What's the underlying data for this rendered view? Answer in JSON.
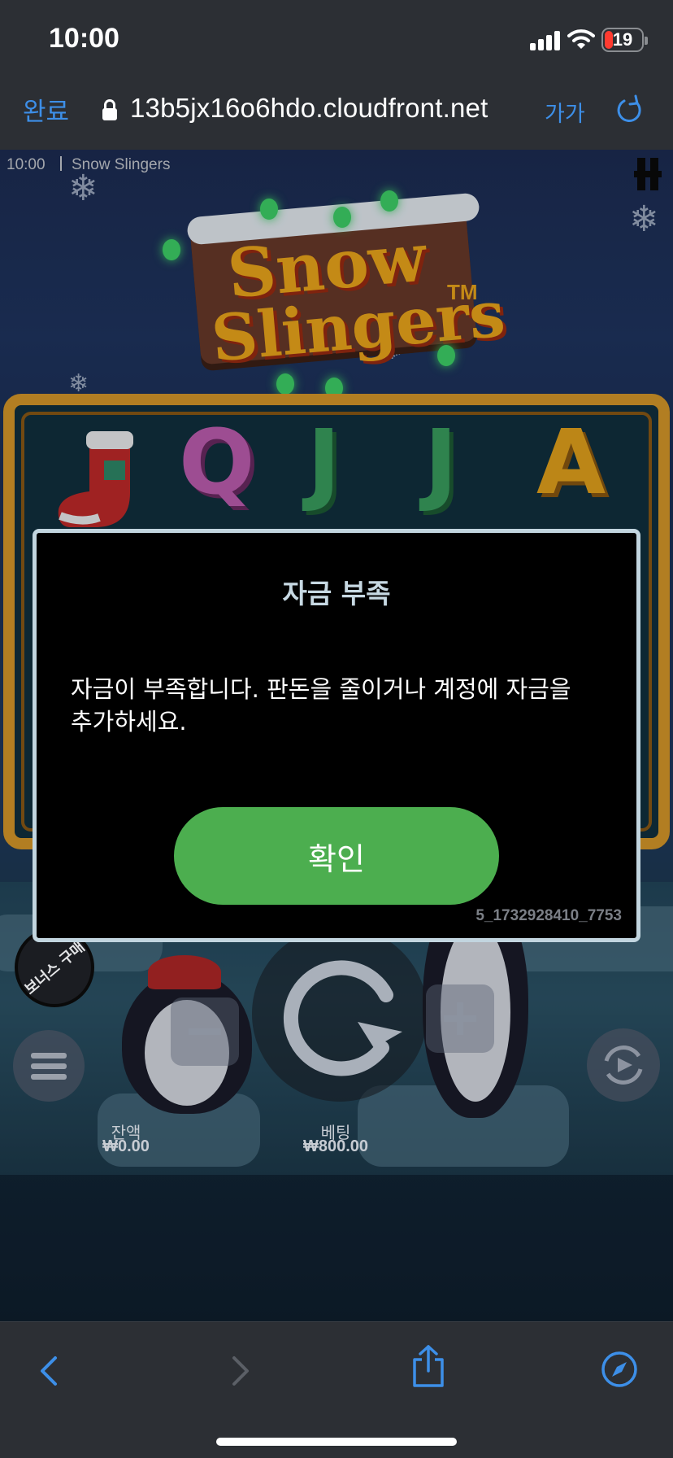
{
  "status_bar": {
    "time": "10:00",
    "battery": "19"
  },
  "url_bar": {
    "done_label": "완료",
    "url": "13b5jx16o6hdo.cloudfront.net",
    "text_size_label": "가가"
  },
  "game": {
    "clock": "10:00",
    "title": "Snow Slingers",
    "logo_line1": "Snow",
    "logo_line2": "Slingers",
    "logo_tm": "TM",
    "reel_symbols": [
      "Q",
      "J",
      "J",
      "A"
    ],
    "bonus_buy_label": "보너스 구매",
    "balance_label": "잔액",
    "balance_value": "₩0.00",
    "bet_label": "베팅",
    "bet_value": "₩800.00"
  },
  "modal": {
    "title": "자금 부족",
    "message_line1": "자금이 부족합니다. 판돈을 줄이거나 계정에 자금을",
    "message_line2": "추가하세요.",
    "confirm_label": "확인",
    "session_id": "5_1732928410_7753"
  },
  "colors": {
    "accent_blue": "#3d8fe8",
    "confirm_green": "#4cae4f",
    "battery_red": "#ff3b30",
    "modal_border": "#c2d5df"
  },
  "icons": [
    "signal-icon",
    "wifi-icon",
    "battery-icon",
    "lock-icon",
    "reload-icon",
    "pause-icon",
    "menu-icon",
    "spin-icon",
    "minus-icon",
    "plus-icon",
    "autoplay-icon",
    "back-icon",
    "forward-icon",
    "share-icon",
    "compass-icon"
  ]
}
